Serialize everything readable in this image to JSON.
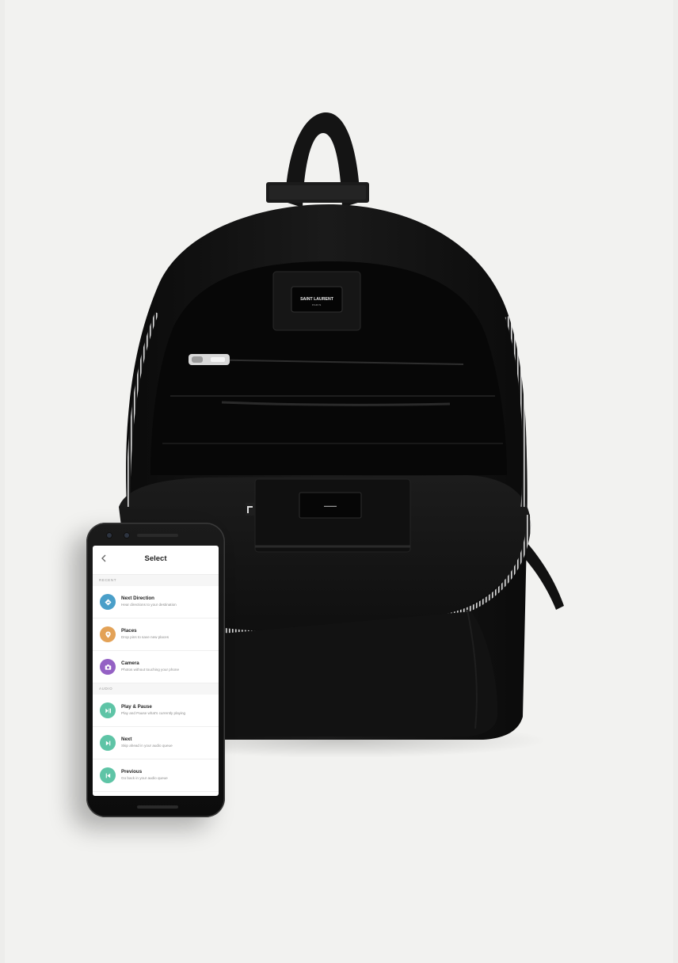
{
  "app": {
    "title": "Select"
  },
  "sections": [
    {
      "label": "Recent",
      "items": [
        {
          "title": "Next Direction",
          "subtitle": "Hear directions to your destination",
          "icon": "direction-icon",
          "color": "#4a9fc9"
        },
        {
          "title": "Places",
          "subtitle": "Drop pins to save new places",
          "icon": "pin-icon",
          "color": "#e3a257"
        },
        {
          "title": "Camera",
          "subtitle": "Photos without touching your phone",
          "icon": "camera-icon",
          "color": "#9461c4"
        }
      ]
    },
    {
      "label": "Audio",
      "items": [
        {
          "title": "Play & Pause",
          "subtitle": "Play and Pause what's currently playing",
          "icon": "play-pause-icon",
          "color": "#5ec4a6"
        },
        {
          "title": "Next",
          "subtitle": "Skip ahead in your audio queue",
          "icon": "skip-next-icon",
          "color": "#5ec4a6"
        },
        {
          "title": "Previous",
          "subtitle": "Go back in your audio queue",
          "icon": "skip-previous-icon",
          "color": "#5ec4a6"
        }
      ]
    }
  ],
  "backpack": {
    "label_line1": "SAINT LAURENT",
    "label_line2": "PARIS"
  }
}
